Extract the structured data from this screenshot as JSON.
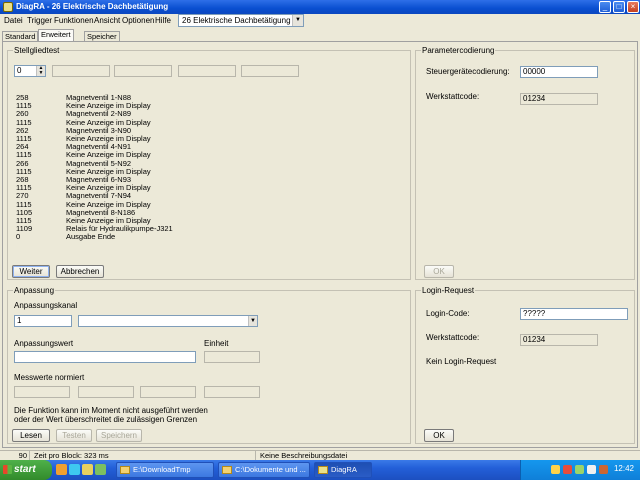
{
  "window": {
    "title": "DiagRA - 26 Elektrische Dachbetätigung",
    "min": "_",
    "max": "□",
    "close": "×"
  },
  "menu": {
    "items": [
      "Datei",
      "Trigger",
      "Funktionen",
      "Ansicht",
      "Optionen",
      "Hilfe"
    ],
    "module_select": "26 Elektrische Dachbetätigung"
  },
  "tabs": [
    "Standard",
    "Erweitert",
    "Speicher"
  ],
  "stellgliedtest": {
    "legend": "Stellgliedtest",
    "spinner_value": "0",
    "rows": [
      {
        "code": "258",
        "desc": "Magnetventil 1-N88"
      },
      {
        "code": "1115",
        "desc": "Keine Anzeige im Display"
      },
      {
        "code": "260",
        "desc": "Magnetventil 2-N89"
      },
      {
        "code": "1115",
        "desc": "Keine Anzeige im Display"
      },
      {
        "code": "262",
        "desc": "Magnetventil 3-N90"
      },
      {
        "code": "1115",
        "desc": "Keine Anzeige im Display"
      },
      {
        "code": "264",
        "desc": "Magnetventil 4-N91"
      },
      {
        "code": "1115",
        "desc": "Keine Anzeige im Display"
      },
      {
        "code": "266",
        "desc": "Magnetventil 5-N92"
      },
      {
        "code": "1115",
        "desc": "Keine Anzeige im Display"
      },
      {
        "code": "268",
        "desc": "Magnetventil 6-N93"
      },
      {
        "code": "1115",
        "desc": "Keine Anzeige im Display"
      },
      {
        "code": "270",
        "desc": "Magnetventil 7-N94"
      },
      {
        "code": "1115",
        "desc": "Keine Anzeige im Display"
      },
      {
        "code": "1105",
        "desc": "Magnetventil 8-N186"
      },
      {
        "code": "1115",
        "desc": "Keine Anzeige im Display"
      },
      {
        "code": "1109",
        "desc": "Relais für Hydraulikpumpe-J321"
      },
      {
        "code": "0",
        "desc": "Ausgabe Ende"
      }
    ],
    "weiter": "Weiter",
    "abbrechen": "Abbrechen"
  },
  "parametercodierung": {
    "legend": "Parametercodierung",
    "steuergeraet_label": "Steuergerätecodierung:",
    "steuergeraet_value": "00000",
    "werkstatt_label": "Werkstattcode:",
    "werkstatt_value": "01234",
    "ok": "OK"
  },
  "anpassung": {
    "legend": "Anpassung",
    "kanal_label": "Anpassungskanal",
    "kanal_value": "1",
    "wert_label": "Anpassungswert",
    "einheit_label": "Einheit",
    "messwerte_label": "Messwerte normiert",
    "info_line1": "Die Funktion kann im Moment nicht ausgeführt werden",
    "info_line2": "oder der Wert überschreitet die zulässigen Grenzen",
    "lesen": "Lesen",
    "testen": "Testen",
    "speichern": "Speichern"
  },
  "login": {
    "legend": "Login-Request",
    "code_label": "Login-Code:",
    "code_value": "?????",
    "werkstatt_label": "Werkstattcode:",
    "werkstatt_value": "01234",
    "status": "Kein Login-Request",
    "ok": "OK"
  },
  "statusbar": {
    "count": "90",
    "time": "Zeit pro Block: 323 ms",
    "desc": "Keine Beschreibungsdatei"
  },
  "taskbar": {
    "start": "start",
    "tasks": [
      "E:\\DownloadTmp",
      "C:\\Dokumente und ...",
      "DiagRA"
    ],
    "clock": "12:42"
  },
  "colors": {
    "titlebar": "#0a4fd0",
    "taskbar": "#235fd8",
    "start": "#328a2b",
    "tray": "#0f7fd8"
  }
}
